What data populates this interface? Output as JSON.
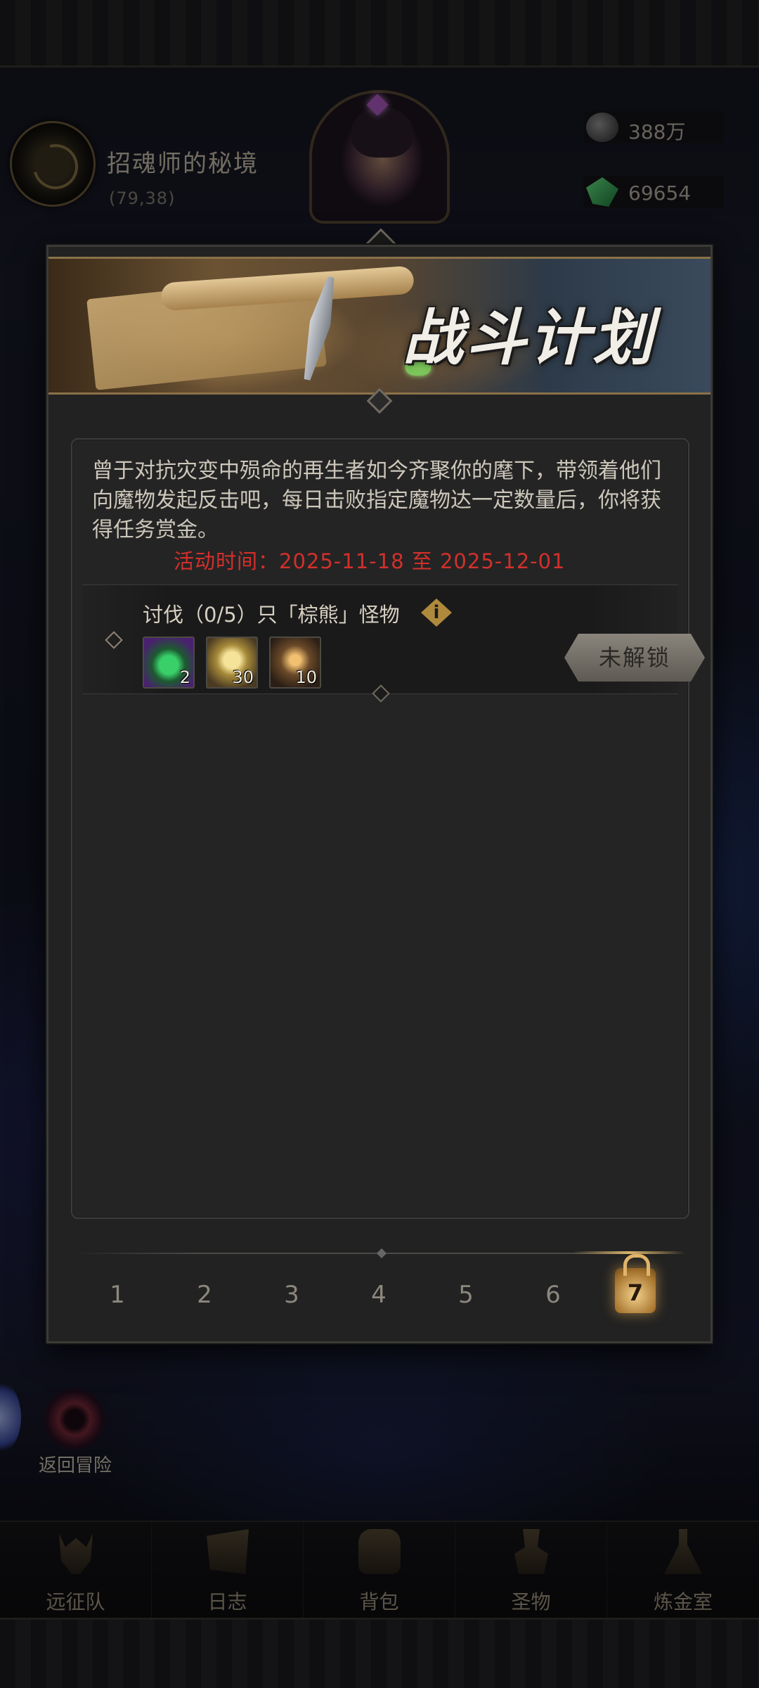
{
  "location": {
    "name": "招魂师的秘境",
    "coord": "(79,38)"
  },
  "resources": {
    "stone": "388万",
    "gem": "69654"
  },
  "scene": {
    "return_label": "返回冒险"
  },
  "modal": {
    "title": "战斗计划",
    "description": "曾于对抗灾变中殒命的再生者如今齐聚你的麾下，带领着他们向魔物发起反击吧，每日击败指定魔物达一定数量后，你将获得任务赏金。",
    "period": "活动时间：2025-11-18 至 2025-12-01",
    "task": {
      "title": "讨伐（0/5）只「棕熊」怪物",
      "info_icon": "i",
      "rewards": [
        {
          "icon": "green-potion-icon",
          "count": "2"
        },
        {
          "icon": "star-icon",
          "count": "30"
        },
        {
          "icon": "lantern-icon",
          "count": "10"
        }
      ],
      "button_label": "未解锁"
    },
    "pages": [
      "1",
      "2",
      "3",
      "4",
      "5",
      "6",
      "7"
    ],
    "active_page": "7"
  },
  "nav": [
    {
      "label": "远征队",
      "icon": "helmet-icon"
    },
    {
      "label": "日志",
      "icon": "scroll-icon"
    },
    {
      "label": "背包",
      "icon": "bag-icon"
    },
    {
      "label": "圣物",
      "icon": "relic-icon"
    },
    {
      "label": "炼金室",
      "icon": "alchemy-icon"
    }
  ],
  "colors": {
    "period_red": "#d2302c",
    "accent_gold": "#d8b36a"
  }
}
